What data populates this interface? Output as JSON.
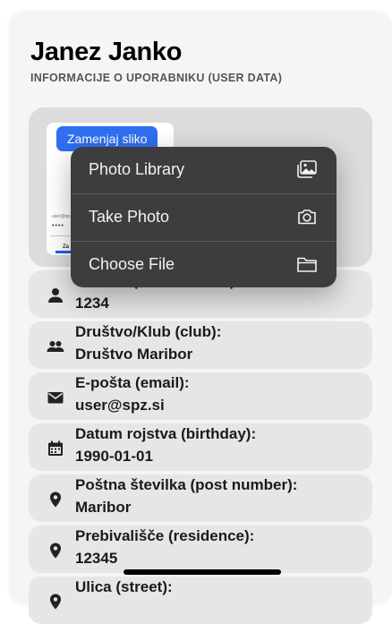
{
  "header": {
    "title": "Janez Janko",
    "subtitle": "INFORMACIJE O UPORABNIKU (USER DATA)"
  },
  "photo": {
    "change_label": "Zamenjaj sliko",
    "thumbnail_text_1": "user@spz.si",
    "thumbnail_text_2": "••••",
    "thumbnail_text_3": "Za"
  },
  "rows": [
    {
      "label": "Št. SPZ (user number):",
      "value": "1234",
      "icon": "person-icon"
    },
    {
      "label": "Društvo/Klub (club):",
      "value": "Društvo Maribor",
      "icon": "group-icon"
    },
    {
      "label": "E-pošta (email):",
      "value": "user@spz.si",
      "icon": "mail-icon"
    },
    {
      "label": "Datum rojstva (birthday):",
      "value": "1990-01-01",
      "icon": "calendar-icon"
    },
    {
      "label": "Poštna številka (post number):",
      "value": "Maribor",
      "icon": "location-icon"
    },
    {
      "label": "Prebivališče (residence):",
      "value": "12345",
      "icon": "location-icon"
    },
    {
      "label": "Ulica (street):",
      "value": "",
      "icon": "location-icon"
    }
  ],
  "menu": {
    "items": [
      {
        "label": "Photo Library",
        "icon": "photo-library-icon"
      },
      {
        "label": "Take Photo",
        "icon": "camera-icon"
      },
      {
        "label": "Choose File",
        "icon": "folder-icon"
      }
    ]
  }
}
